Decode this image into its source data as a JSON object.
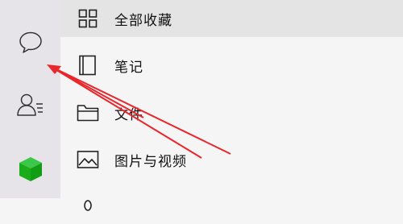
{
  "sidebar": {
    "icons": [
      "chat-bubble-icon",
      "contacts-icon",
      "mini-program-cube-icon"
    ],
    "accent": "#1aad19"
  },
  "menu": {
    "items": [
      {
        "label": "全部收藏",
        "icon": "grid-icon",
        "active": true
      },
      {
        "label": "笔记",
        "icon": "notebook-icon",
        "active": false
      },
      {
        "label": "文件",
        "icon": "folder-icon",
        "active": false
      },
      {
        "label": "图片与视频",
        "icon": "image-icon",
        "active": false
      },
      {
        "label": "",
        "icon": "link-icon",
        "active": false
      }
    ]
  },
  "annotation": {
    "color": "#e8262b"
  }
}
